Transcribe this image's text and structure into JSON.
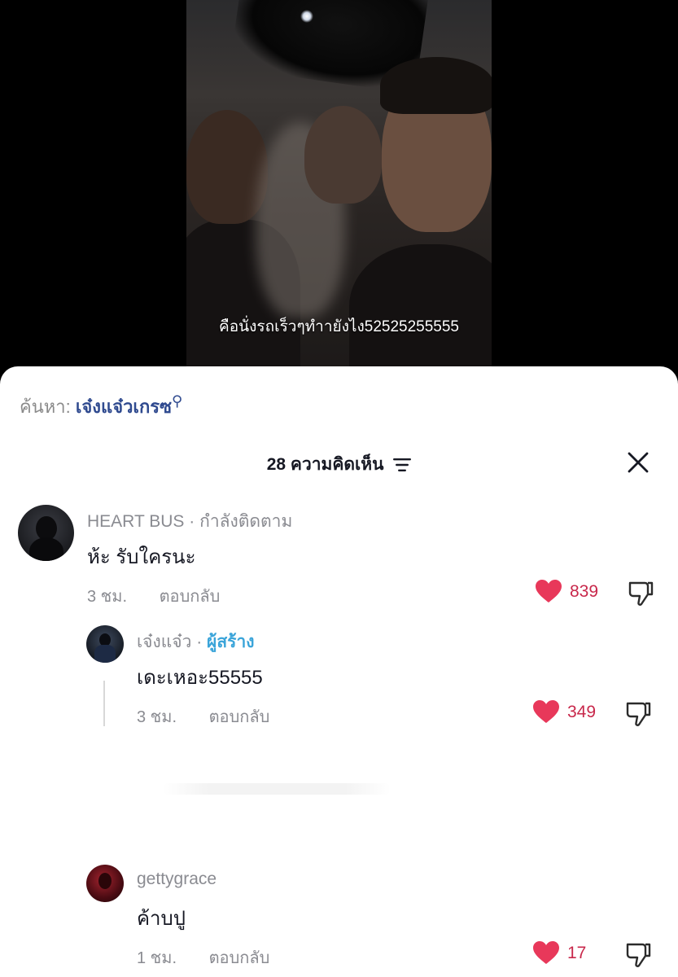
{
  "video": {
    "caption": "คือนั่งรถเร็วๆทำายังไง52525255555"
  },
  "search": {
    "prefix": "ค้นหา:",
    "term": "เจ๋งแจ๋วเกรซ"
  },
  "comments_header": {
    "title": "28 ความคิดเห็น"
  },
  "comments": [
    {
      "username": "HEART BUS",
      "badge": "· กำลังติดตาม",
      "text": "ห้ะ รับใครนะ",
      "time": "3 ชม.",
      "reply_label": "ตอบกลับ",
      "likes": "839"
    },
    {
      "username": "เจ๋งแจ๋ว",
      "separator": " · ",
      "badge": "ผู้สร้าง",
      "text": "เดะเหอะ55555",
      "time": "3 ชม.",
      "reply_label": "ตอบกลับ",
      "likes": "349"
    },
    {
      "username": "gettygrace",
      "text": "ค้าบปู",
      "time": "1 ชม.",
      "reply_label": "ตอบกลับ",
      "likes": "17"
    }
  ],
  "colors": {
    "like": "#e8385a",
    "creator": "#3aa4d9",
    "search_term": "#2f4a8f"
  }
}
